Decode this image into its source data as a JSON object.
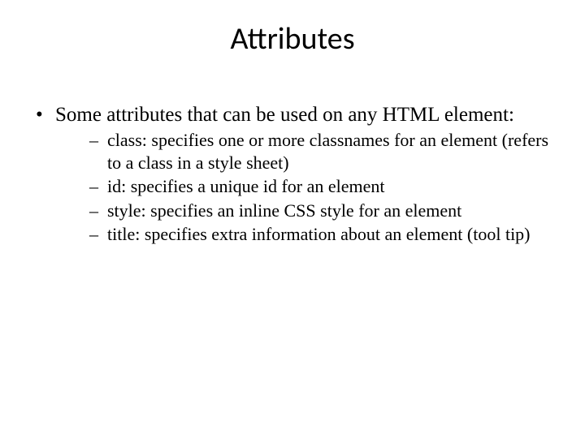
{
  "slide": {
    "title": "Attributes",
    "intro": "Some attributes that can be used on any HTML element:",
    "items": [
      "class: specifies one or more classnames for an element (refers to a class in a style sheet)",
      "id: specifies a unique id for an element",
      "style: specifies an inline CSS style for an element",
      "title: specifies extra information about an element (tool tip)"
    ]
  }
}
